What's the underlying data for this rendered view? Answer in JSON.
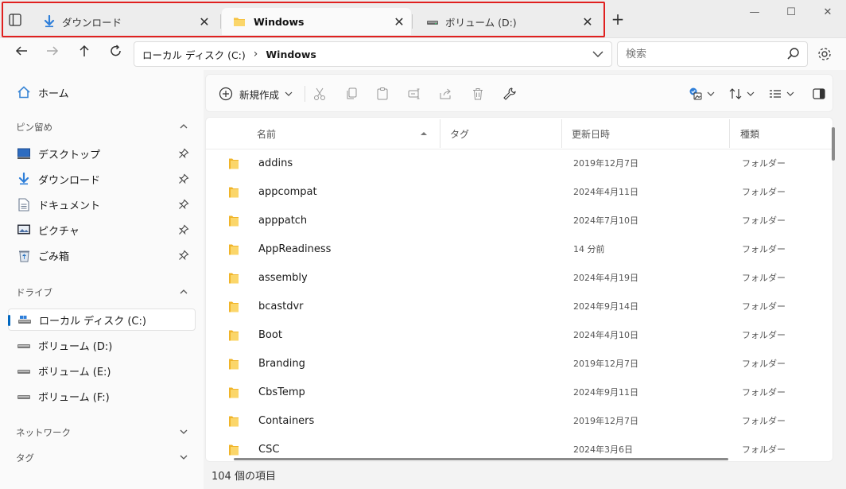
{
  "tabs": [
    {
      "label": "ダウンロード",
      "close": "✕"
    },
    {
      "label": "Windows",
      "close": "✕"
    },
    {
      "label": "ボリューム (D:)",
      "close": "✕"
    }
  ],
  "window": {
    "minimize": "—",
    "maximize": "☐",
    "close": "✕",
    "new_tab": "+"
  },
  "nav": {
    "breadcrumb": [
      "ローカル ディスク (C:)",
      "Windows"
    ],
    "breadcrumb_sep": "›",
    "search_placeholder": "検索"
  },
  "sidebar": {
    "home": "ホーム",
    "pinned_header": "ピン留め",
    "pinned": [
      {
        "label": "デスクトップ",
        "icon": "desktop-icon"
      },
      {
        "label": "ダウンロード",
        "icon": "download-icon"
      },
      {
        "label": "ドキュメント",
        "icon": "document-icon"
      },
      {
        "label": "ピクチャ",
        "icon": "pictures-icon"
      },
      {
        "label": "ごみ箱",
        "icon": "recycle-bin-icon"
      }
    ],
    "drives_header": "ドライブ",
    "drives": [
      {
        "label": "ローカル ディスク (C:)",
        "selected": true
      },
      {
        "label": "ボリューム (D:)",
        "selected": false
      },
      {
        "label": "ボリューム (E:)",
        "selected": false
      },
      {
        "label": "ボリューム (F:)",
        "selected": false
      }
    ],
    "network": "ネットワーク",
    "tags": "タグ"
  },
  "toolbar": {
    "new_label": "新規作成"
  },
  "columns": {
    "name": "名前",
    "tag": "タグ",
    "modified": "更新日時",
    "type": "種類"
  },
  "files": [
    {
      "name": "addins",
      "modified": "2019年12月7日",
      "type": "フォルダー"
    },
    {
      "name": "appcompat",
      "modified": "2024年4月11日",
      "type": "フォルダー"
    },
    {
      "name": "apppatch",
      "modified": "2024年7月10日",
      "type": "フォルダー"
    },
    {
      "name": "AppReadiness",
      "modified": "14 分前",
      "type": "フォルダー"
    },
    {
      "name": "assembly",
      "modified": "2024年4月19日",
      "type": "フォルダー"
    },
    {
      "name": "bcastdvr",
      "modified": "2024年9月14日",
      "type": "フォルダー"
    },
    {
      "name": "Boot",
      "modified": "2024年4月10日",
      "type": "フォルダー"
    },
    {
      "name": "Branding",
      "modified": "2019年12月7日",
      "type": "フォルダー"
    },
    {
      "name": "CbsTemp",
      "modified": "2024年9月11日",
      "type": "フォルダー"
    },
    {
      "name": "Containers",
      "modified": "2019年12月7日",
      "type": "フォルダー"
    },
    {
      "name": "CSC",
      "modified": "2024年3月6日",
      "type": "フォルダー"
    }
  ],
  "status": {
    "item_count": "104 個の項目"
  },
  "colors": {
    "highlight": "#e0201f",
    "accent": "#0067c0",
    "folder": "#f6c343"
  }
}
